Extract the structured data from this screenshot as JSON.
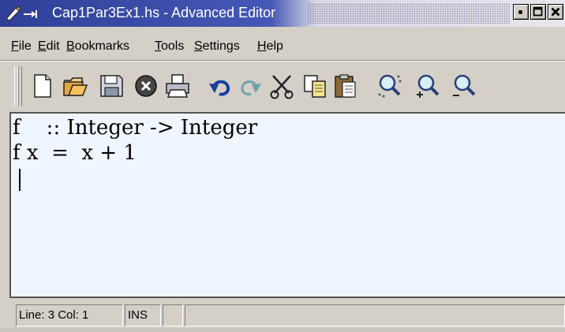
{
  "window": {
    "title": "Cap1Par3Ex1.hs - Advanced Editor",
    "minimize_label": "minimize",
    "maximize_label": "maximize",
    "close_label": "close"
  },
  "menu": {
    "items": [
      {
        "label": "File",
        "mnemonic": "F",
        "rest": "ile"
      },
      {
        "label": "Edit",
        "mnemonic": "E",
        "rest": "dit"
      },
      {
        "label": "Bookmarks",
        "mnemonic": "B",
        "rest": "ookmarks"
      },
      {
        "label": "Tools",
        "mnemonic": "T",
        "rest": "ools"
      },
      {
        "label": "Settings",
        "mnemonic": "S",
        "rest": "ettings"
      },
      {
        "label": "Help",
        "mnemonic": "H",
        "rest": "elp"
      }
    ]
  },
  "toolbar": {
    "icons": [
      "new-document-icon",
      "open-folder-icon",
      "save-disk-icon",
      "close-document-icon",
      "print-icon",
      "undo-icon",
      "redo-icon",
      "cut-icon",
      "copy-icon",
      "paste-icon",
      "find-icon",
      "zoom-in-icon",
      "zoom-out-icon"
    ]
  },
  "editor": {
    "lines": [
      {
        "name": "f",
        "sep": "    :: ",
        "rest": "Integer -> Integer"
      },
      {
        "name": "f x",
        "sep": "  =  ",
        "rest": "x + 1"
      }
    ]
  },
  "status": {
    "position": "Line: 3 Col: 1",
    "mode": "INS",
    "extra": ""
  },
  "colors": {
    "titlebar": "#3a4fa8",
    "editor_bg": "#f0f6ff",
    "chrome": "#d4d0c8"
  }
}
